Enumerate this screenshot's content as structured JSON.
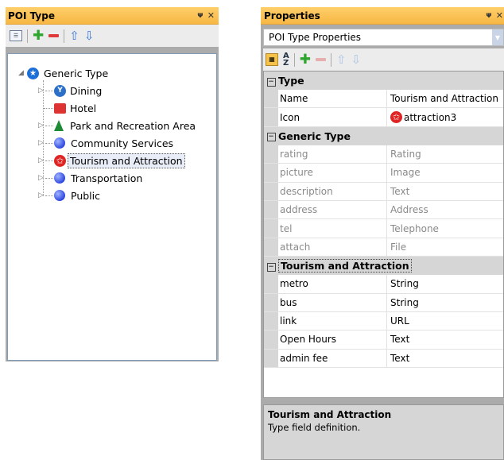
{
  "poi_panel": {
    "title": "POI Type",
    "pin_glyph": "p",
    "close_glyph": "✕",
    "tree": {
      "root": {
        "label": "Generic Type",
        "icon": "blue-star-icon"
      },
      "children": [
        {
          "label": "Dining",
          "icon": "dining-icon",
          "expandable": true
        },
        {
          "label": "Hotel",
          "icon": "hotel-icon",
          "expandable": false
        },
        {
          "label": "Park and Recreation Area",
          "icon": "tree-icon",
          "expandable": true
        },
        {
          "label": "Community Services",
          "icon": "blue-ball-icon",
          "expandable": true
        },
        {
          "label": "Tourism and Attraction",
          "icon": "red-star-icon",
          "expandable": true,
          "selected": true
        },
        {
          "label": "Transportation",
          "icon": "blue-ball-icon",
          "expandable": true
        },
        {
          "label": "Public",
          "icon": "blue-ball-icon",
          "expandable": true
        }
      ]
    }
  },
  "properties_panel": {
    "title": "Properties",
    "object_selector": "POI Type Properties",
    "categories": [
      {
        "title": "Type",
        "rows": [
          {
            "name": "Name",
            "value": "Tourism and Attraction"
          },
          {
            "name": "Icon",
            "value": "attraction3",
            "icon": "red-star-icon"
          }
        ]
      },
      {
        "title": "Generic Type",
        "rows": [
          {
            "name": "rating",
            "value": "Rating"
          },
          {
            "name": "picture",
            "value": "Image"
          },
          {
            "name": "description",
            "value": "Text"
          },
          {
            "name": "address",
            "value": "Address"
          },
          {
            "name": "tel",
            "value": "Telephone"
          },
          {
            "name": "attach",
            "value": "File"
          }
        ]
      },
      {
        "title": "Tourism and Attraction",
        "rows": [
          {
            "name": "metro",
            "value": "String"
          },
          {
            "name": "bus",
            "value": "String"
          },
          {
            "name": "link",
            "value": "URL"
          },
          {
            "name": "Open Hours",
            "value": "Text"
          },
          {
            "name": "admin fee",
            "value": "Text"
          }
        ]
      }
    ],
    "description": {
      "title": "Tourism and Attraction",
      "text": "Type field definition."
    }
  },
  "colors": {
    "header_orange": "#f7b744",
    "category_gray": "#d6d6d6",
    "selection": "#e9edf7"
  }
}
